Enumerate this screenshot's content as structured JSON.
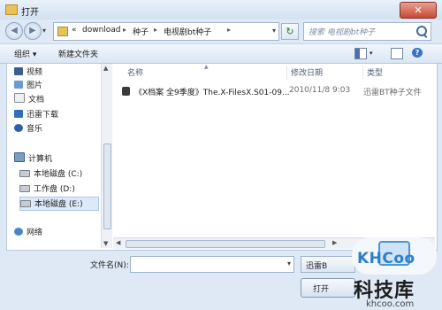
{
  "window": {
    "title": "打开",
    "close_label": "✕"
  },
  "address_bar": {
    "overflow": "«",
    "path": [
      "download",
      "种子",
      "电视剧bt种子"
    ],
    "separator": "▸"
  },
  "search": {
    "placeholder": "搜索 电视剧bt种子"
  },
  "toolbar": {
    "organize": "组织 ▾",
    "new_folder": "新建文件夹"
  },
  "nav_pane": {
    "items": [
      {
        "label": "视频",
        "icon": "video-library-icon"
      },
      {
        "label": "图片",
        "icon": "picture-library-icon"
      },
      {
        "label": "文档",
        "icon": "document-library-icon"
      },
      {
        "label": "迅雷下载",
        "icon": "thunder-download-icon"
      },
      {
        "label": "音乐",
        "icon": "music-library-icon"
      },
      {
        "label": "计算机",
        "icon": "computer-icon"
      },
      {
        "label": "本地磁盘 (C:)",
        "icon": "drive-icon"
      },
      {
        "label": "工作盘 (D:)",
        "icon": "drive-icon"
      },
      {
        "label": "本地磁盘 (E:)",
        "icon": "drive-icon"
      },
      {
        "label": "网络",
        "icon": "network-icon"
      }
    ]
  },
  "file_list": {
    "columns": {
      "name": "名称",
      "modified": "修改日期",
      "type": "类型"
    },
    "rows": [
      {
        "name": "《X档案 全9季度》The.X-FilesX.S01-09...",
        "modified": "2010/11/8 9:03",
        "type": "迅雷BT种子文件"
      }
    ]
  },
  "bottom": {
    "filename_label": "文件名(N):",
    "filename_value": "",
    "filetype_value": "迅雷B",
    "open_label": "打开"
  },
  "watermark": {
    "logo": "KHCoo",
    "cn": "科技库",
    "url": "khcoo.com"
  }
}
